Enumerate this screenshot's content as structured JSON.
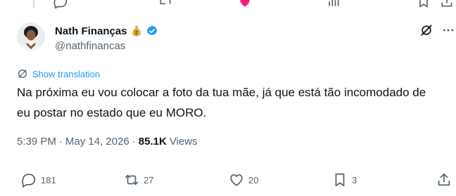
{
  "author": {
    "display_name": "Nath Finanças",
    "handle": "@nathfinancas",
    "verified": true,
    "name_emoji": "money-bag-icon"
  },
  "translate": {
    "label": "Show translation"
  },
  "tweet": {
    "text": "Na próxima eu vou colocar a foto da tua mãe, já que está tão incomodado de eu postar no estado que eu MORO."
  },
  "meta": {
    "time": "5:39 PM",
    "date": "May 14, 2026",
    "views_count": "85.1K",
    "views_label": "Views",
    "separator": "·"
  },
  "actions": {
    "replies": "181",
    "reposts": "27",
    "likes": "20",
    "bookmarks": "3"
  },
  "colors": {
    "accent": "#1d9bf0",
    "secondary_text": "#536471",
    "like_pink": "#f91880"
  }
}
